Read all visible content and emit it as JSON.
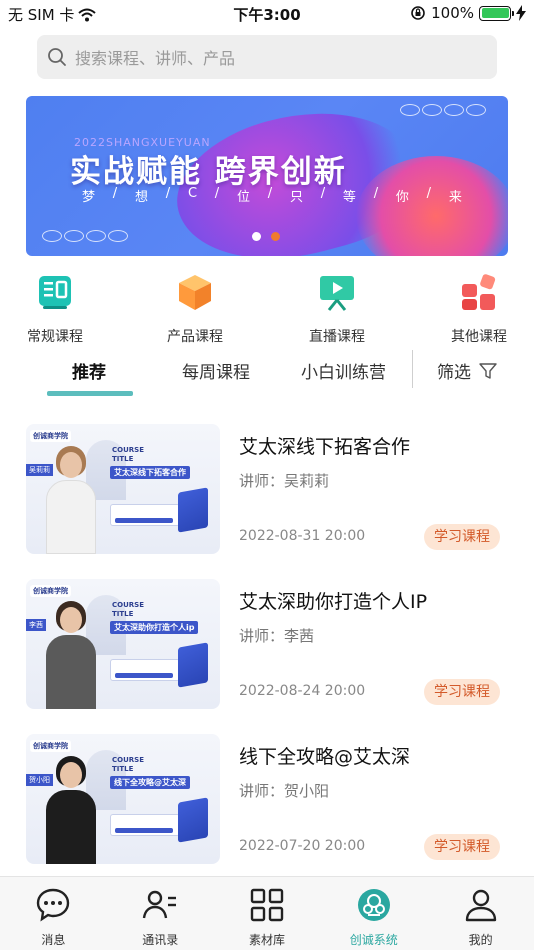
{
  "status_bar": {
    "carrier": "无 SIM 卡",
    "time": "下午3:00",
    "battery": "100%"
  },
  "search": {
    "placeholder": "搜索课程、讲师、产品"
  },
  "banner": {
    "sub_en": "2022SHANGXUEYUAN",
    "headline": "实战赋能 跨界创新",
    "slogan": [
      "梦",
      "想",
      "C",
      "位",
      "只",
      "等",
      "你",
      "来"
    ],
    "active_dot": 2
  },
  "categories": [
    {
      "label": "常规课程",
      "icon": "book-icon"
    },
    {
      "label": "产品课程",
      "icon": "box-icon"
    },
    {
      "label": "直播课程",
      "icon": "live-screen-icon"
    },
    {
      "label": "其他课程",
      "icon": "apps-icon"
    }
  ],
  "tabs": {
    "items": [
      "推荐",
      "每周课程",
      "小白训练营"
    ],
    "active": "推荐",
    "filter_label": "筛选"
  },
  "courses": [
    {
      "title": "艾太深线下拓客合作",
      "teacher": "讲师：吴莉莉",
      "date": "2022-08-31 20:00",
      "badge": "学习课程",
      "thumb": {
        "logo": "创诚商学院",
        "course_label": "COURSE",
        "course_title": "TITLE",
        "name": "艾太深线下拓客合作",
        "person_tag": "吴莉莉",
        "hair": "#a87a52",
        "outfit": "#f2f2f2"
      }
    },
    {
      "title": "艾太深助你打造个人IP",
      "teacher": "讲师：李茜",
      "date": "2022-08-24 20:00",
      "badge": "学习课程",
      "thumb": {
        "logo": "创诚商学院",
        "course_label": "COURSE",
        "course_title": "TITLE",
        "name": "艾太深助你打造个人ip",
        "person_tag": "李茜",
        "hair": "#3b2a20",
        "outfit": "#5a5a5a"
      }
    },
    {
      "title": "线下全攻略@艾太深",
      "teacher": "讲师：贺小阳",
      "date": "2022-07-20 20:00",
      "badge": "学习课程",
      "thumb": {
        "logo": "创诚商学院",
        "course_label": "COURSE",
        "course_title": "TITLE",
        "name": "线下全攻略@艾太深",
        "person_tag": "贺小阳",
        "hair": "#1b1b1b",
        "outfit": "#1d1d1d"
      }
    }
  ],
  "bottom_nav": [
    {
      "label": "消息",
      "icon": "chat-bubble-icon"
    },
    {
      "label": "通讯录",
      "icon": "contacts-icon"
    },
    {
      "label": "素材库",
      "icon": "grid-icon"
    },
    {
      "label": "创诚系统",
      "icon": "system-logo-icon",
      "active": true
    },
    {
      "label": "我的",
      "icon": "person-icon"
    }
  ],
  "colors": {
    "accent": "#2aa7a0",
    "tab_underline": "#5cbdbd",
    "badge_bg": "#fde5d4",
    "badge_text": "#d35a2a",
    "banner_blue": "#4f7ff0",
    "dot_active": "#f07b2c"
  }
}
